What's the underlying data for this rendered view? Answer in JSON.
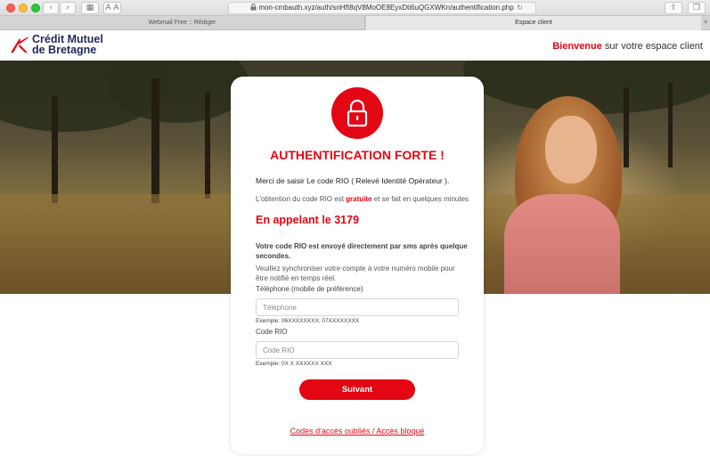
{
  "browser": {
    "address_url": "mon-cmbauth.xyz/auth/snHfI8qV8MoOE8EyxDti6uQGXWKn/authentification.php",
    "reader_label": "A A",
    "tabs": [
      {
        "label": "Webmail Free :: Rédiger"
      },
      {
        "label": "Espace client"
      }
    ],
    "new_tab_symbol": "+"
  },
  "header": {
    "logo_line1": "Crédit Mutuel",
    "logo_line2": "de Bretagne",
    "welcome_strong": "Bienvenue",
    "welcome_rest": " sur votre espace client"
  },
  "card": {
    "title": "AUTHENTIFICATION FORTE !",
    "intro": "Merci de saisir Le code RIO ( Relevé Identité Opérateur ).",
    "obtention_before": "L'obtention du code RIO est ",
    "obtention_strong": "gratuite",
    "obtention_after": " et se fait en quelques minutes",
    "call_text": "En appelant le 3179",
    "sms_text": "Votre code RIO est envoyé directement par sms après quelque secondes.",
    "sync_text": "Veuillez synchroniser votre compte à votre numéro mobile pour être notifié en temps réel.",
    "phone_label": "Téléphone (mobile de préférence)",
    "phone_placeholder": "Téléphone",
    "phone_hint": "Exemple: 06XXXXXXXX; 07XXXXXXXX",
    "rio_label": "Code RIO",
    "rio_placeholder": "Code RIO",
    "rio_hint": "Exemple: 0X X XXXXXX XXX",
    "submit_label": "Suivant",
    "forgot_link": "Codes d'accès oubliés / Accès bloqué"
  },
  "colors": {
    "brand_red": "#e30613",
    "brand_navy": "#1e2a5a"
  },
  "icons": [
    "lock-icon",
    "back-icon",
    "forward-icon",
    "sidebar-icon",
    "secure-lock-icon",
    "reload-icon",
    "share-icon",
    "tabs-icon"
  ]
}
